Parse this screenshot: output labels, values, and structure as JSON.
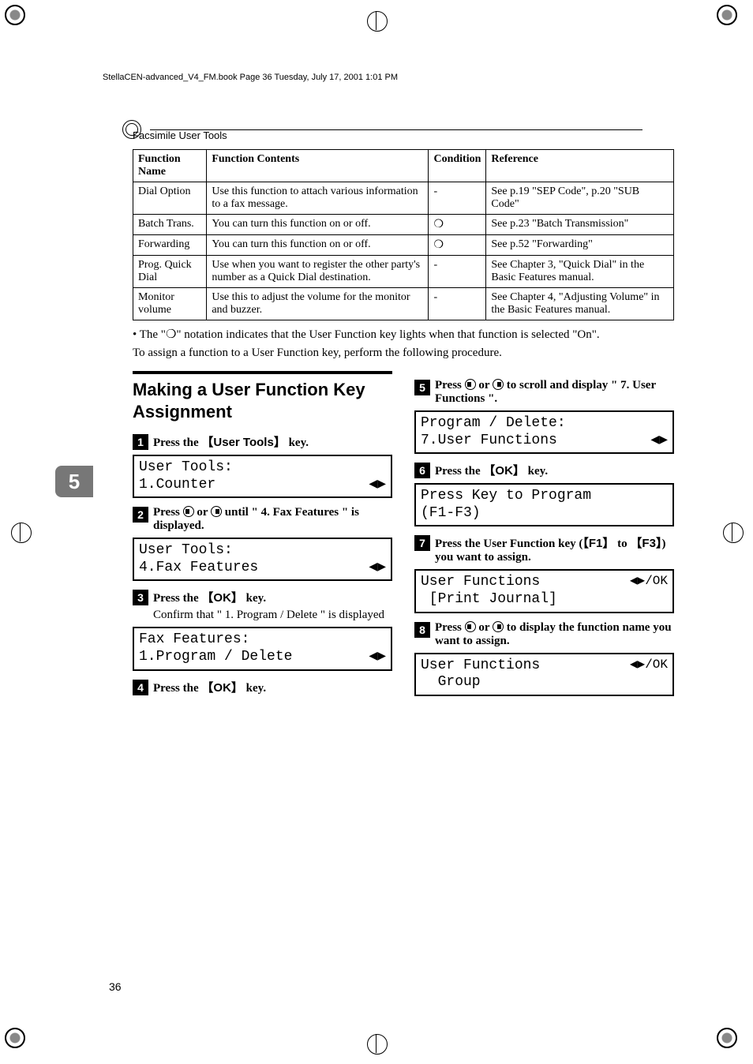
{
  "book_header": "StellaCEN-advanced_V4_FM.book  Page 36  Tuesday, July 17, 2001  1:01 PM",
  "section_title": "Facsimile User Tools",
  "chapter_tab": "5",
  "page_number": "36",
  "table": {
    "headers": [
      "Function Name",
      "Function Contents",
      "Condition",
      "Reference"
    ],
    "rows": [
      {
        "name": "Dial Option",
        "contents": "Use this function to attach various information to a fax message.",
        "condition": "-",
        "reference": "See p.19 \"SEP Code\", p.20 \"SUB Code\""
      },
      {
        "name": "Batch Trans.",
        "contents": "You can turn this function on or off.",
        "condition": "❍",
        "reference": "See p.23 \"Batch Transmission\""
      },
      {
        "name": "Forwarding",
        "contents": "You can turn this function on or off.",
        "condition": "❍",
        "reference": "See p.52 \"Forwarding\""
      },
      {
        "name": "Prog. Quick Dial",
        "contents": "Use when you want to register the other party's number as a Quick Dial destination.",
        "condition": "-",
        "reference": "See Chapter 3, \"Quick Dial\" in the Basic Features manual."
      },
      {
        "name": "Monitor volume",
        "contents": "Use this to adjust the volume for the monitor and buzzer.",
        "condition": "-",
        "reference": "See Chapter 4, \"Adjusting Volume\" in the Basic Features manual."
      }
    ]
  },
  "bullet_note_pre": "•  The \"",
  "bullet_note_post": "\" notation indicates that the User Function key lights when that function is selected \"On\".",
  "assign_note": "To assign a function to a User Function key, perform the following procedure.",
  "heading": "Making a User Function Key Assignment",
  "steps_left": [
    {
      "n": "1",
      "pre": "Press the ",
      "key": "User Tools",
      "post": " key.",
      "lcd": "User Tools:\n1.Counter",
      "arrows": true
    },
    {
      "n": "2",
      "pre": "Press ",
      "circles": true,
      "post": " until \" 4. Fax Features \" is displayed.",
      "lcd": "User Tools:\n4.Fax Features",
      "arrows": true
    },
    {
      "n": "3",
      "pre": "Press the ",
      "key": "OK",
      "post": " key.",
      "sub": "Confirm that \" 1. Program / Delete \" is displayed",
      "lcd": "Fax Features:\n1.Program / Delete",
      "arrows": true
    },
    {
      "n": "4",
      "pre": "Press the ",
      "key": "OK",
      "post": " key."
    }
  ],
  "steps_right": [
    {
      "n": "5",
      "pre": "Press ",
      "circles": true,
      "post": " to scroll and display \" 7. User Functions \".",
      "lcd": "Program / Delete:\n7.User Functions",
      "arrows": true
    },
    {
      "n": "6",
      "pre": "Press the ",
      "key": "OK",
      "post": " key.",
      "lcd": "Press Key to Program\n(F1-F3)"
    },
    {
      "n": "7",
      "pre": "Press the User Function key (",
      "key": "F1",
      "post_mid": " to ",
      "key2": "F3",
      "post": ") you want to assign.",
      "lcd": "User Functions\n [Print Journal]",
      "ok": true
    },
    {
      "n": "8",
      "pre": "Press ",
      "circles": true,
      "post": " to display the function name you want to assign.",
      "lcd": "User Functions\n  Group",
      "ok": true
    }
  ]
}
